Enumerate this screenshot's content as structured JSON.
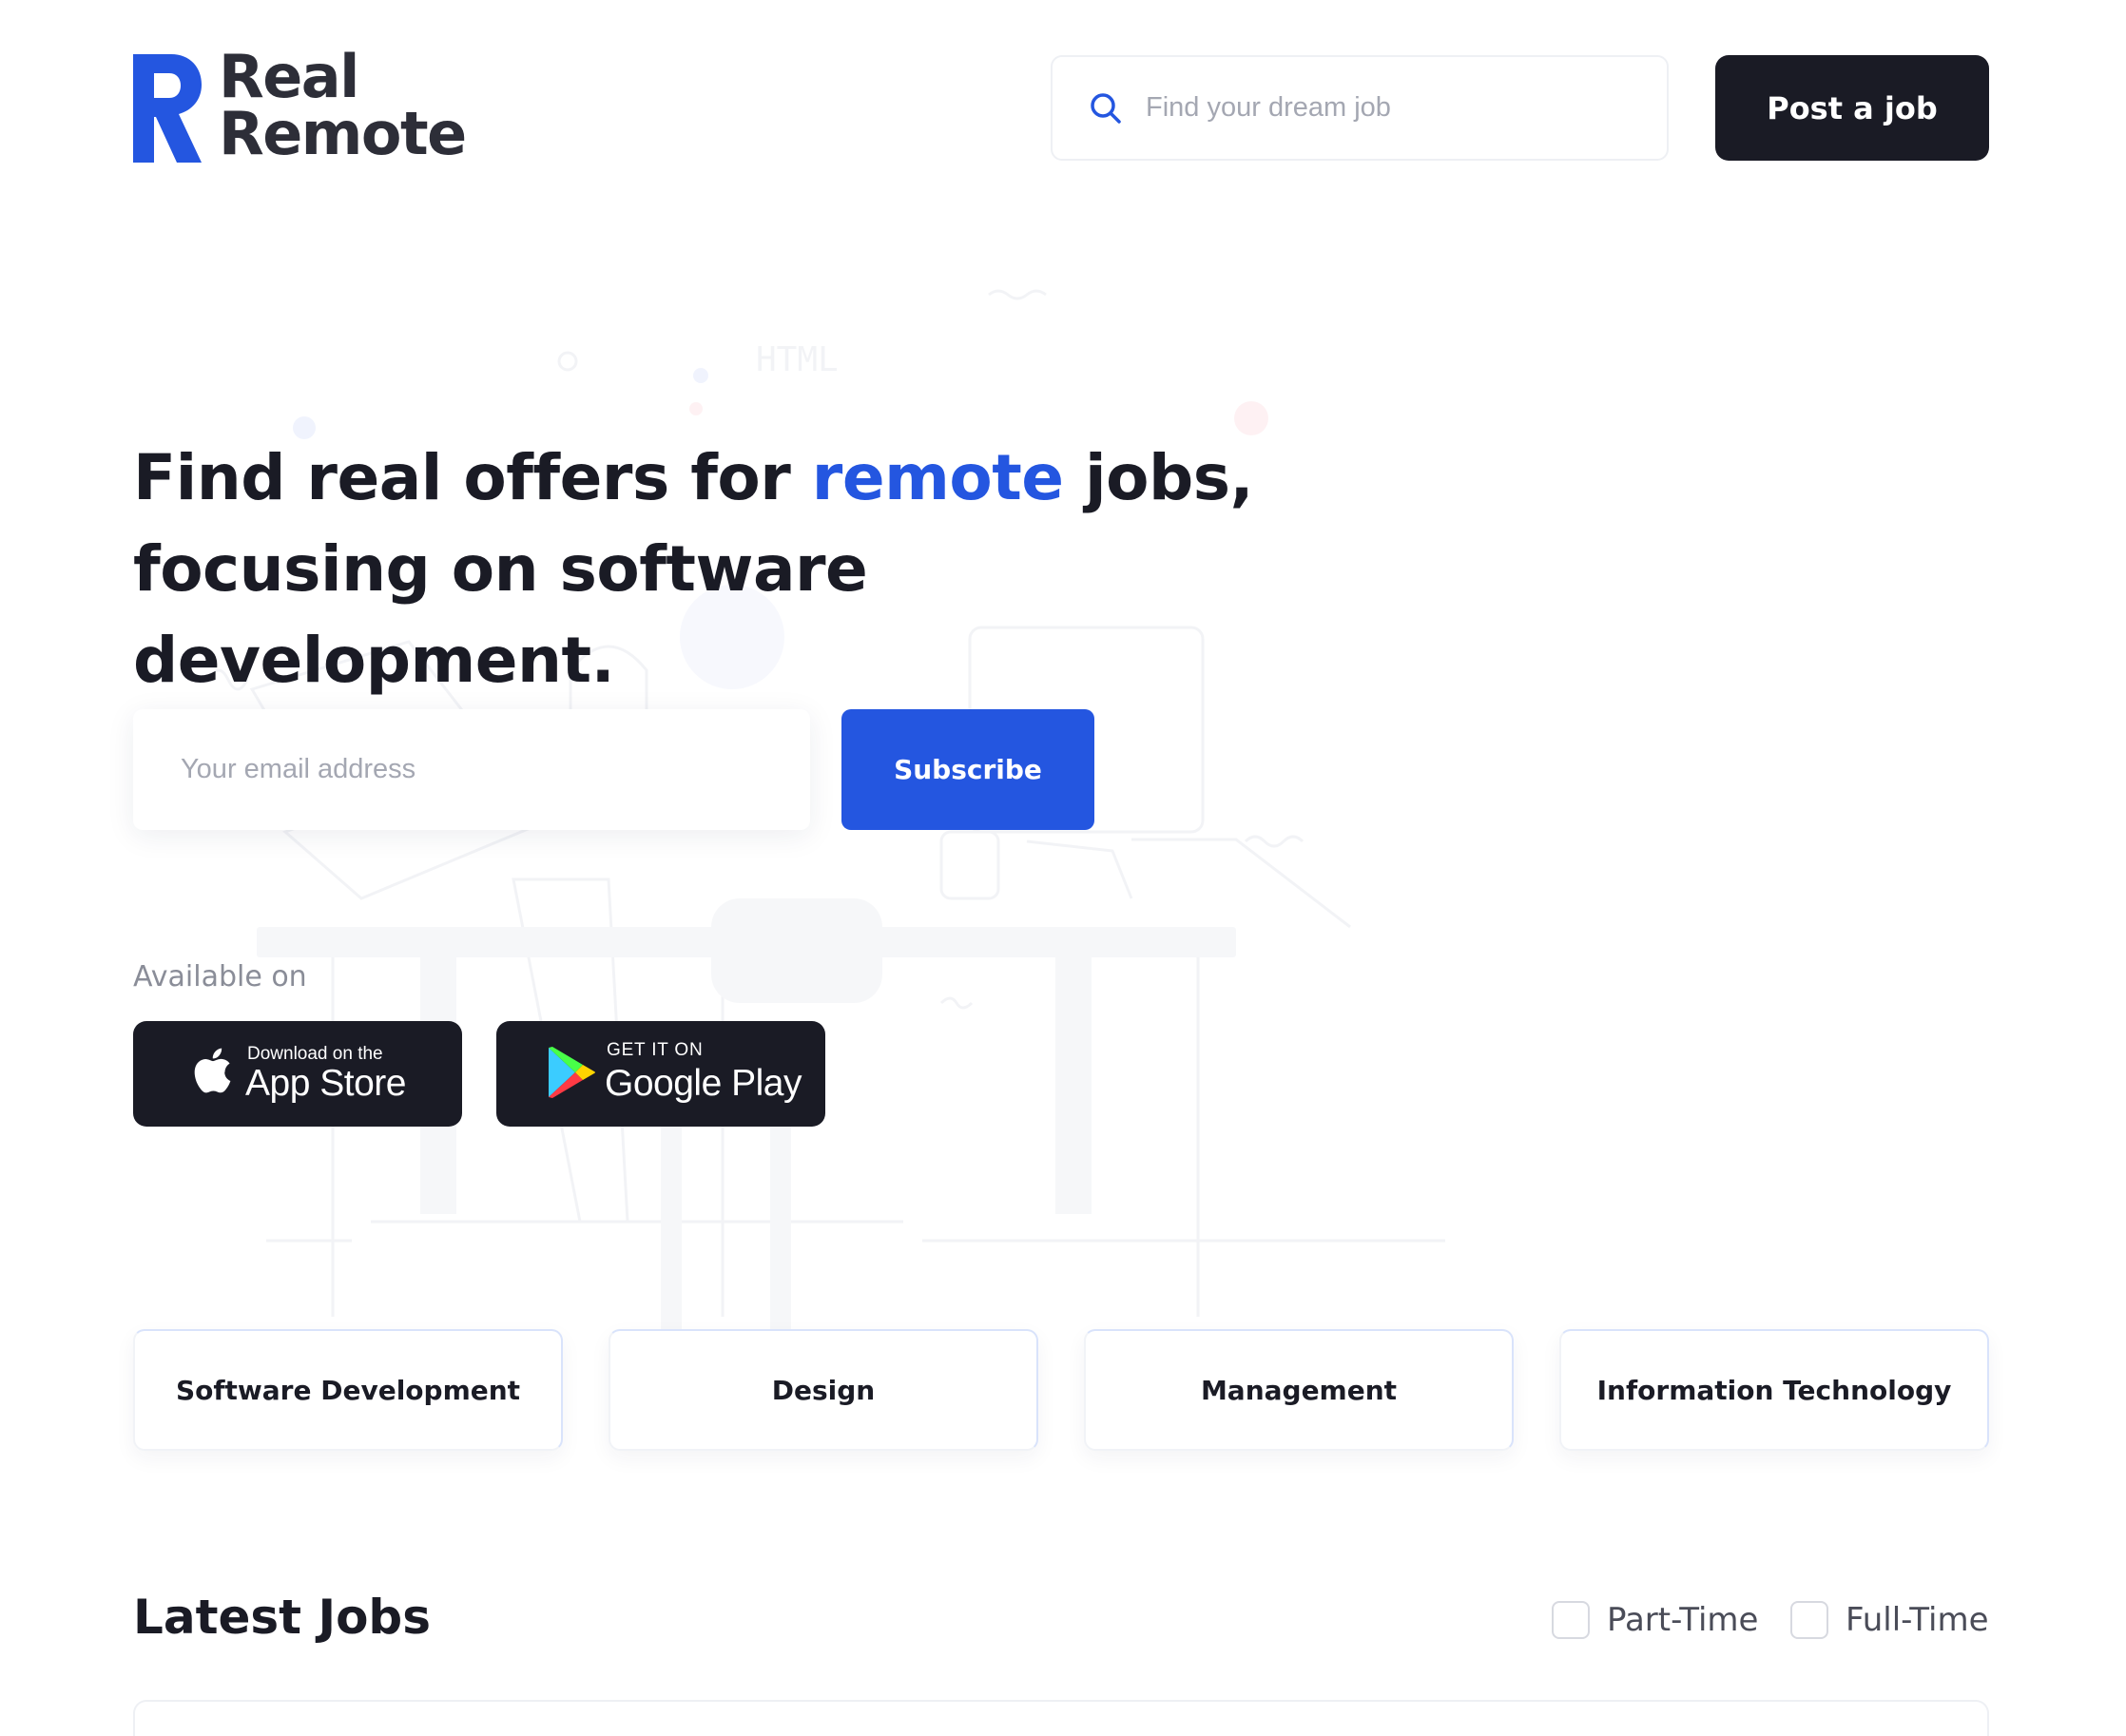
{
  "brand": {
    "line1": "Real",
    "line2": "Remote",
    "accent_color": "#2456e0",
    "dark_color": "#1a1b25"
  },
  "header": {
    "search_placeholder": "Find your dream job",
    "search_icon": "search-icon",
    "post_job_label": "Post a job"
  },
  "hero": {
    "title_part1": "Find real offers for ",
    "title_accent": "remote",
    "title_part2": " jobs,",
    "title_line2": "focusing on software development.",
    "illustration_text": "HTML"
  },
  "subscribe": {
    "email_placeholder": "Your email address",
    "button_label": "Subscribe"
  },
  "apps": {
    "available_label": "Available on",
    "app_store": {
      "small": "Download on the",
      "big": "App Store",
      "icon": "apple-icon"
    },
    "google_play": {
      "small": "GET IT ON",
      "big": "Google Play",
      "icon": "google-play-icon"
    }
  },
  "categories": [
    {
      "label": "Software Development"
    },
    {
      "label": "Design"
    },
    {
      "label": "Management"
    },
    {
      "label": "Information Technology"
    }
  ],
  "jobs": {
    "heading": "Latest Jobs",
    "filters": [
      {
        "label": "Part-Time",
        "checked": false
      },
      {
        "label": "Full-Time",
        "checked": false
      }
    ]
  }
}
